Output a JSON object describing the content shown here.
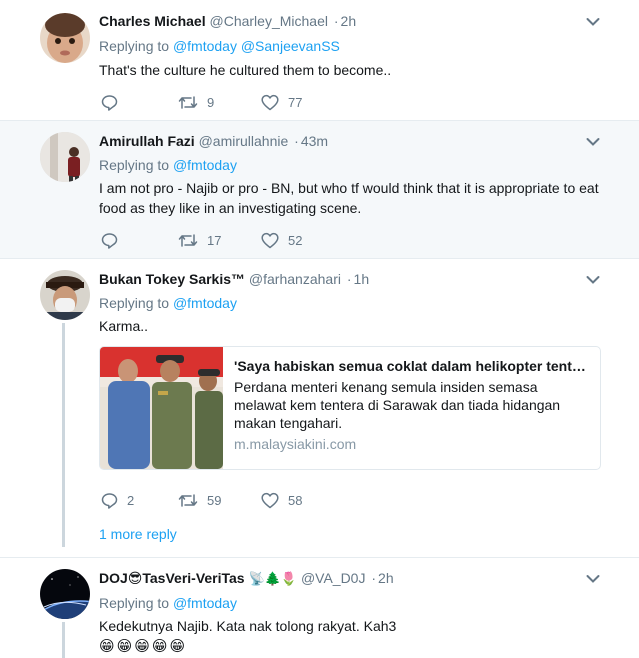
{
  "tweets": [
    {
      "name": "Charles Michael",
      "handle": "@Charley_Michael",
      "dot": "·",
      "time": "2h",
      "replying_label": "Replying to",
      "replying_to": [
        "@fmtoday",
        "@SanjeevanSS"
      ],
      "text": "That's the culture he cultured them to become..",
      "replies": "",
      "retweets": "9",
      "likes": "77"
    },
    {
      "name": "Amirullah Fazi",
      "handle": "@amirullahnie",
      "dot": "·",
      "time": "43m",
      "replying_label": "Replying to",
      "replying_to": [
        "@fmtoday"
      ],
      "text": "I am not pro - Najib or pro - BN, but who tf would think that it is appropriate to eat food as they like in an investigating scene.",
      "replies": "",
      "retweets": "17",
      "likes": "52"
    },
    {
      "name": "Bukan Tokey Sarkis™",
      "handle": "@farhanzahari",
      "dot": "·",
      "time": "1h",
      "replying_label": "Replying to",
      "replying_to": [
        "@fmtoday"
      ],
      "text": "Karma..",
      "card": {
        "title": "'Saya habiskan semua coklat dalam helikopter tentera'",
        "description": "Perdana menteri kenang semula insiden semasa melawat kem tentera di Sarawak dan tiada hidangan makan tengahari.",
        "url": "m.malaysiakini.com"
      },
      "replies": "2",
      "retweets": "59",
      "likes": "58",
      "more_reply": "1 more reply"
    },
    {
      "name": "DOJ😎TasVeri-VeriTas",
      "name_emoji": "📡🌲🌷",
      "handle": "@VA_D0J",
      "dot": "·",
      "time": "2h",
      "replying_label": "Replying to",
      "replying_to": [
        "@fmtoday"
      ],
      "text": "Kedekutnya Najib. Kata nak tolong rakyat. Kah3",
      "emojis": "😁😁😁😁😁"
    }
  ],
  "icons": {
    "reply": "reply-icon",
    "retweet": "retweet-icon",
    "like": "heart-icon",
    "more": "chevron-down-icon"
  },
  "colors": {
    "link": "#1da1f2",
    "muted": "#657786",
    "highlight_bg": "#f5f8fa"
  }
}
